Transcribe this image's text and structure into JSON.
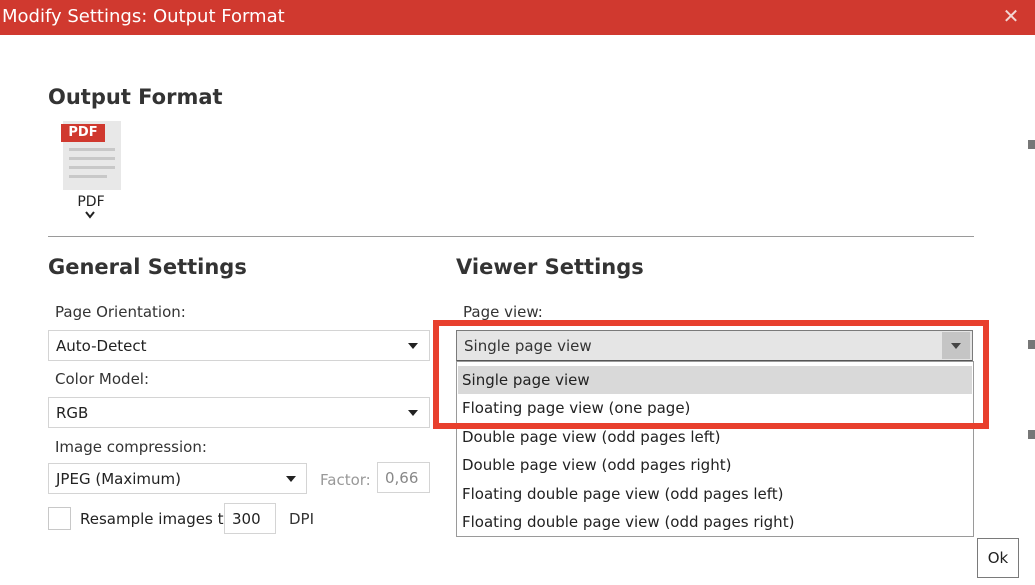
{
  "window": {
    "title": "Modify Settings: Output Format",
    "close_symbol": "✕"
  },
  "output_format": {
    "heading": "Output Format",
    "icon_badge": "PDF",
    "selected_label": "PDF"
  },
  "general_settings": {
    "heading": "General Settings",
    "page_orientation": {
      "label": "Page Orientation:",
      "value": "Auto-Detect"
    },
    "color_model": {
      "label": "Color Model:",
      "value": "RGB"
    },
    "image_compression": {
      "label": "Image compression:",
      "value": "JPEG (Maximum)"
    },
    "factor": {
      "label": "Factor:",
      "value": "0,66"
    },
    "resample": {
      "label": "Resample images to",
      "value": "300",
      "unit": "DPI",
      "checked": false
    }
  },
  "viewer_settings": {
    "heading": "Viewer Settings",
    "page_view": {
      "label": "Page view:",
      "value": "Single page view",
      "options": [
        "Single page view",
        "Floating page view (one page)",
        "Double page view (odd pages left)",
        "Double page view (odd pages right)",
        "Floating double page view (odd pages left)",
        "Floating double page view (odd pages right)"
      ],
      "selected_index": 0
    }
  },
  "footer": {
    "ok_label": "Ok"
  },
  "colors": {
    "accent": "#d0392f",
    "highlight": "#e8402d"
  }
}
